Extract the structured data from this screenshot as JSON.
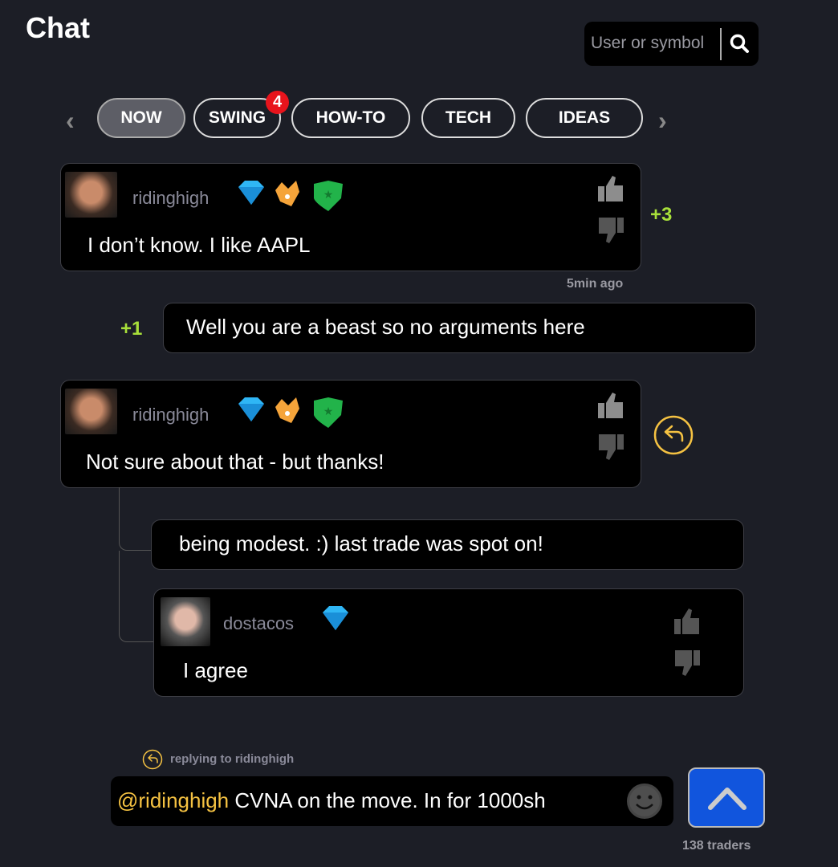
{
  "header": {
    "title": "Chat",
    "search_placeholder": "User or symbol",
    "search_icon": "magnifier"
  },
  "tabs": [
    {
      "label": "NOW",
      "active": true
    },
    {
      "label": "SWING",
      "badge": "4"
    },
    {
      "label": "HOW-TO"
    },
    {
      "label": "TECH"
    },
    {
      "label": "IDEAS"
    }
  ],
  "messages": [
    {
      "user": "ridinghigh",
      "badges": [
        "diamond",
        "crown",
        "shield"
      ],
      "text": "I don’t know.  I like AAPL",
      "score": "+3",
      "time": "5min ago"
    },
    {
      "text": "Well you are a beast so no arguments here",
      "score": "+1"
    },
    {
      "user": "ridinghigh",
      "badges": [
        "diamond",
        "crown",
        "shield"
      ],
      "text": "Not sure about that - but thanks!"
    },
    {
      "text": "being modest.  :) last trade was spot on!"
    },
    {
      "user": "dostacos",
      "badges": [
        "diamond"
      ],
      "text": "I agree"
    }
  ],
  "composer": {
    "replying_label": "replying to ridinghigh",
    "mention": "@ridinghigh",
    "text": " CVNA on the move.  In for 1000sh",
    "send_icon": "chevron-up",
    "emoji_icon": "smiley"
  },
  "footer": {
    "traders": "138 traders"
  },
  "colors": {
    "background": "#1c1e26",
    "score": "#a8e03a",
    "mention": "#f5c242",
    "send": "#1155dd",
    "badge": "#e8141c"
  }
}
